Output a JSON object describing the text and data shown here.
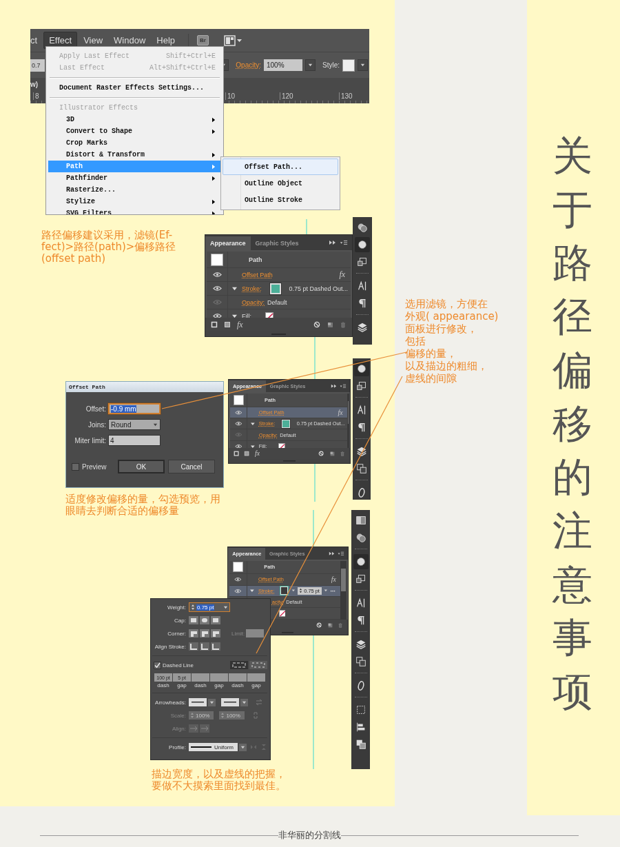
{
  "title": "关于路径偏移的注意事项",
  "menu_screenshot": {
    "menubar": [
      {
        "label": "ct",
        "selected": false
      },
      {
        "label": "Effect",
        "selected": true
      },
      {
        "label": "View",
        "selected": false
      },
      {
        "label": "Window",
        "selected": false
      },
      {
        "label": "Help",
        "selected": false
      }
    ],
    "bridge_button": "Br",
    "stroke_field": "0.7",
    "opacity_label": "Opacity:",
    "opacity": "100%",
    "style_label": "Style:",
    "doc_tab": "w)",
    "ruler": [
      "8",
      "10",
      "120",
      "130"
    ],
    "menu": [
      {
        "kind": "item",
        "label": "Apply Last Effect",
        "shortcut": "Shift+Ctrl+E",
        "disabled": true,
        "selected": false
      },
      {
        "kind": "item",
        "label": "Last Effect",
        "shortcut": "Alt+Shift+Ctrl+E",
        "disabled": true,
        "selected": false
      },
      {
        "kind": "separator"
      },
      {
        "kind": "item",
        "label": "Document Raster Effects Settings...",
        "disabled": false,
        "selected": false
      },
      {
        "kind": "separator"
      },
      {
        "kind": "header",
        "label": "Illustrator Effects",
        "children": [
          {
            "label": "3D",
            "submenu": true,
            "selected": false
          },
          {
            "label": "Convert to Shape",
            "submenu": true,
            "selected": false
          },
          {
            "label": "Crop Marks",
            "submenu": false,
            "selected": false
          },
          {
            "label": "Distort & Transform",
            "submenu": true,
            "selected": false
          },
          {
            "label": "Path",
            "submenu": true,
            "selected": true
          },
          {
            "label": "Pathfinder",
            "submenu": true,
            "selected": false
          },
          {
            "label": "Rasterize...",
            "submenu": false,
            "selected": false
          },
          {
            "label": "Stylize",
            "submenu": true,
            "selected": false
          },
          {
            "label": "SVG Filters",
            "submenu": true,
            "selected": false
          }
        ]
      }
    ],
    "submenu": [
      {
        "label": "Offset Path...",
        "selected": true
      },
      {
        "label": "Outline Object",
        "selected": false
      },
      {
        "label": "Outline Stroke",
        "selected": false
      }
    ]
  },
  "notes": [
    {
      "lines": [
        "路径偏移建议采用，滤镜(Ef-",
        "fect)>路径(path)>偏移路径",
        "(offset path)"
      ]
    },
    {
      "lines": [
        "选用滤镜，方便在",
        "外观( appearance)",
        "面板进行修改，",
        "包括",
        "偏移的量，",
        "以及描边的粗细，",
        "虚线的间隙"
      ]
    },
    {
      "lines": [
        "适度修改偏移的量，勾选预览，用",
        "眼睛去判断合适的偏移量"
      ]
    },
    {
      "lines": [
        "描边宽度，以及虚线的把握，",
        "要做不大摸索里面找到最佳。"
      ]
    }
  ],
  "appearance_panels": [
    {
      "tabs": [
        {
          "label": "Appearance",
          "selected": true
        },
        {
          "label": "Graphic Styles",
          "selected": false
        }
      ],
      "object": "Path",
      "fx_button": "fx",
      "rows": [
        {
          "kind": "effect",
          "label": "Offset Path",
          "fx": "fx",
          "visible": true,
          "selected": false
        },
        {
          "kind": "stroke",
          "label": "Stroke:",
          "value": "0.75 pt Dashed Out...",
          "visible": true,
          "expanded": true,
          "selected": false
        },
        {
          "kind": "opacity",
          "label": "Opacity:",
          "value": "Default",
          "visible": false,
          "selected": false
        },
        {
          "kind": "fill",
          "label": "Fill:",
          "visible": true,
          "expanded": true,
          "selected": false
        }
      ]
    },
    {
      "tabs": [
        {
          "label": "Appearance",
          "selected": true
        },
        {
          "label": "Graphic Styles",
          "selected": false
        }
      ],
      "object": "Path",
      "fx_button": "fx",
      "rows": [
        {
          "kind": "effect",
          "label": "Offset Path",
          "fx": "fx",
          "visible": true,
          "selected": true
        },
        {
          "kind": "stroke",
          "label": "Stroke:",
          "value": "0.75 pt Dashed Out...",
          "visible": true,
          "expanded": true,
          "selected": false
        },
        {
          "kind": "opacity",
          "label": "Opacity:",
          "value": "Default",
          "visible": false,
          "selected": false
        },
        {
          "kind": "fill",
          "label": "Fill:",
          "visible": true,
          "expanded": true,
          "selected": false
        }
      ]
    },
    {
      "tabs": [
        {
          "label": "Appearance",
          "selected": true
        },
        {
          "label": "Graphic Styles",
          "selected": false
        }
      ],
      "object": "Path",
      "rows": [
        {
          "kind": "effect",
          "label": "Offset Path",
          "fx": "fx",
          "visible": true,
          "selected": false
        },
        {
          "kind": "stroke_weight",
          "label": "Stroke:",
          "weight": "0.75 pt",
          "visible": true,
          "expanded": true,
          "selected": true
        },
        {
          "kind": "opacity",
          "label": "acity:",
          "value": "Default",
          "selected": false
        },
        {
          "kind": "fill",
          "selected": false
        }
      ]
    }
  ],
  "offset_dialog": {
    "title": "Offset Path",
    "fields": [
      {
        "kind": "text",
        "label": "Offset:",
        "value": "-0.9 mm",
        "selected": true
      },
      {
        "kind": "select",
        "label": "Joins:",
        "value": "Round",
        "selected": false
      },
      {
        "kind": "text",
        "label": "Miter limit:",
        "value": "4",
        "selected": false
      }
    ],
    "preview": {
      "label": "Preview",
      "checked": false
    },
    "buttons": [
      {
        "label": "OK",
        "selected": true
      },
      {
        "label": "Cancel",
        "selected": false
      }
    ]
  },
  "stroke_panel": {
    "weight_label": "Weight:",
    "weight": "0.75 pt",
    "cap_label": "Cap:",
    "corner_label": "Corner:",
    "limit_label": "Limit:",
    "align_label": "Align Stroke:",
    "dashed": {
      "label": "Dashed Line",
      "checked": true
    },
    "dashes": [
      {
        "value": "100 pt",
        "label": "dash"
      },
      {
        "value": "5 pt",
        "label": "gap"
      },
      {
        "label": "dash"
      },
      {
        "label": "gap"
      },
      {
        "label": "dash"
      },
      {
        "label": "gap"
      }
    ],
    "arrowheads_label": "Arrowheads:",
    "scale_label": "Scale:",
    "scales": [
      "100%",
      "100%"
    ],
    "arrow_align_label": "Align:",
    "profile_label": "Profile:",
    "profile": "Uniform"
  },
  "footer": "非华丽的分割线"
}
